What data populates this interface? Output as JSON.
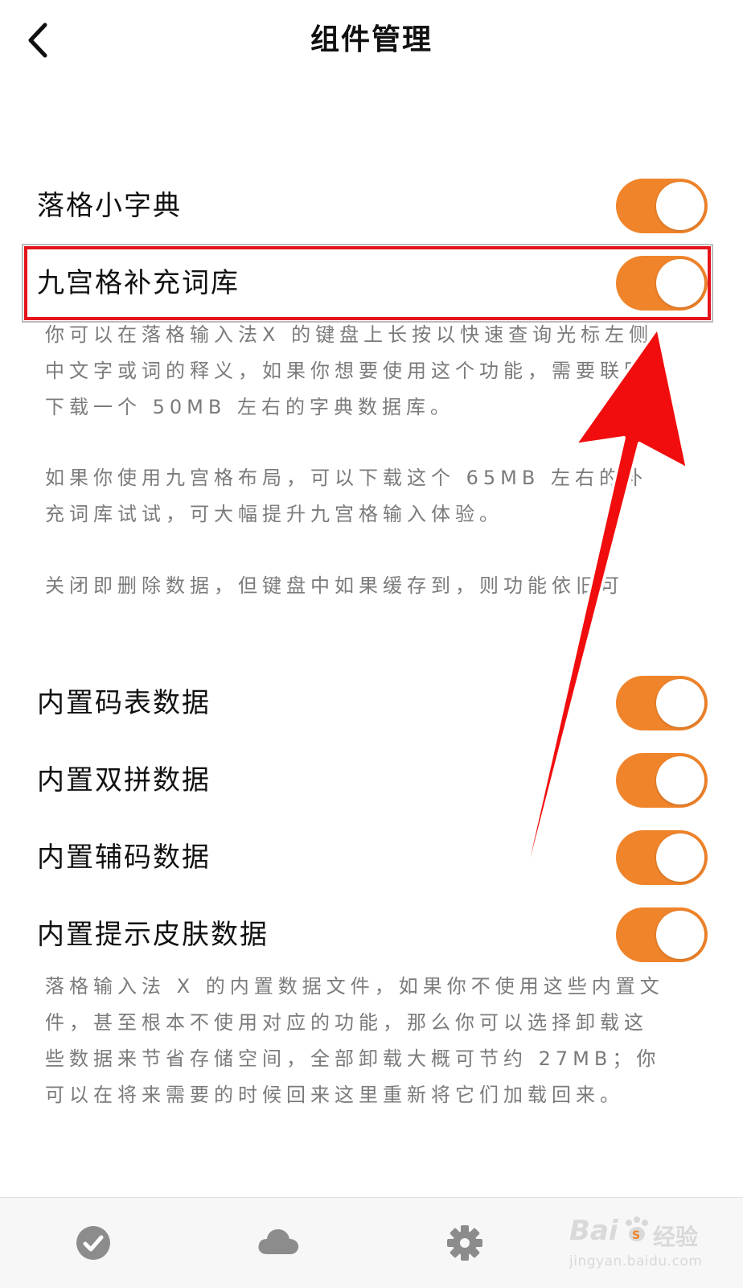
{
  "nav": {
    "title": "组件管理"
  },
  "settings": {
    "dictionary": {
      "label": "落格小字典",
      "enabled": true
    },
    "nine_grid_lexicon": {
      "label": "九宫格补充词库",
      "enabled": true
    },
    "builtin_code_table": {
      "label": "内置码表数据",
      "enabled": true
    },
    "builtin_shuangpin": {
      "label": "内置双拼数据",
      "enabled": true
    },
    "builtin_auxiliary_code": {
      "label": "内置辅码数据",
      "enabled": true
    },
    "builtin_hint_skin": {
      "label": "内置提示皮肤数据",
      "enabled": true
    }
  },
  "descriptions": {
    "dictionary_lines": [
      "你可以在落格输入法X 的键盘上长按以快速查询光标左侧",
      "中文字或词的释义，如果你想要使用这个功能，需要联网",
      "下载一个 50MB 左右的字典数据库。"
    ],
    "nine_grid_lines": [
      "如果你使用九宫格布局，可以下载这个 65MB 左右的补",
      "充词库试试，可大幅提升九宫格输入体验。"
    ],
    "close_note": "关闭即删除数据，但键盘中如果缓存到，则功能依旧可",
    "builtin_lines": [
      "落格输入法 X 的内置数据文件，如果你不使用这些内置文",
      "件，甚至根本不使用对应的功能，那么你可以选择卸载这",
      "些数据来节省存储空间，全部卸载大概可节约 27MB；你",
      "可以在将来需要的时候回来这里重新将它们加载回来。"
    ]
  },
  "colors": {
    "toggle_on": "#f0842b",
    "highlight": "#e5141b",
    "arrow": "#f10d0d",
    "tab_icon": "#8c8c8c"
  },
  "tab_bar": {
    "icons": [
      "check-circle-icon",
      "cloud-icon",
      "gear-icon"
    ]
  },
  "watermark": {
    "brand": "Bai",
    "brand_cn": "经验",
    "sub": "jingyan.baidu.com"
  }
}
